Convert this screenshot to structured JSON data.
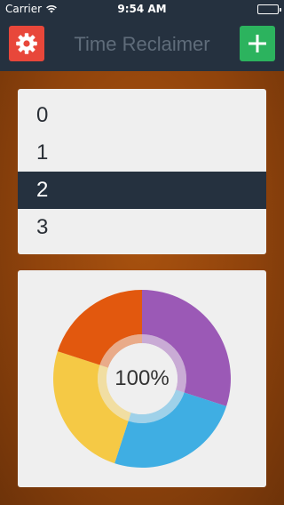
{
  "status_bar": {
    "carrier": "Carrier",
    "time": "9:54 AM"
  },
  "header": {
    "title": "Time Reclaimer",
    "settings_icon": "gear-icon",
    "add_icon": "plus-icon",
    "settings_color": "#e8473a",
    "add_color": "#2cb35e",
    "bar_color": "#25313f"
  },
  "picker": {
    "items": [
      "0",
      "1",
      "2",
      "3"
    ],
    "selected_index": 2
  },
  "chart_data": {
    "type": "pie",
    "center_label": "100%",
    "slices": [
      {
        "color": "#9b59b6",
        "value": 30
      },
      {
        "color": "#3faee3",
        "value": 25
      },
      {
        "color": "#f5c945",
        "value": 25
      },
      {
        "color": "#e2580e",
        "value": 20
      }
    ]
  }
}
